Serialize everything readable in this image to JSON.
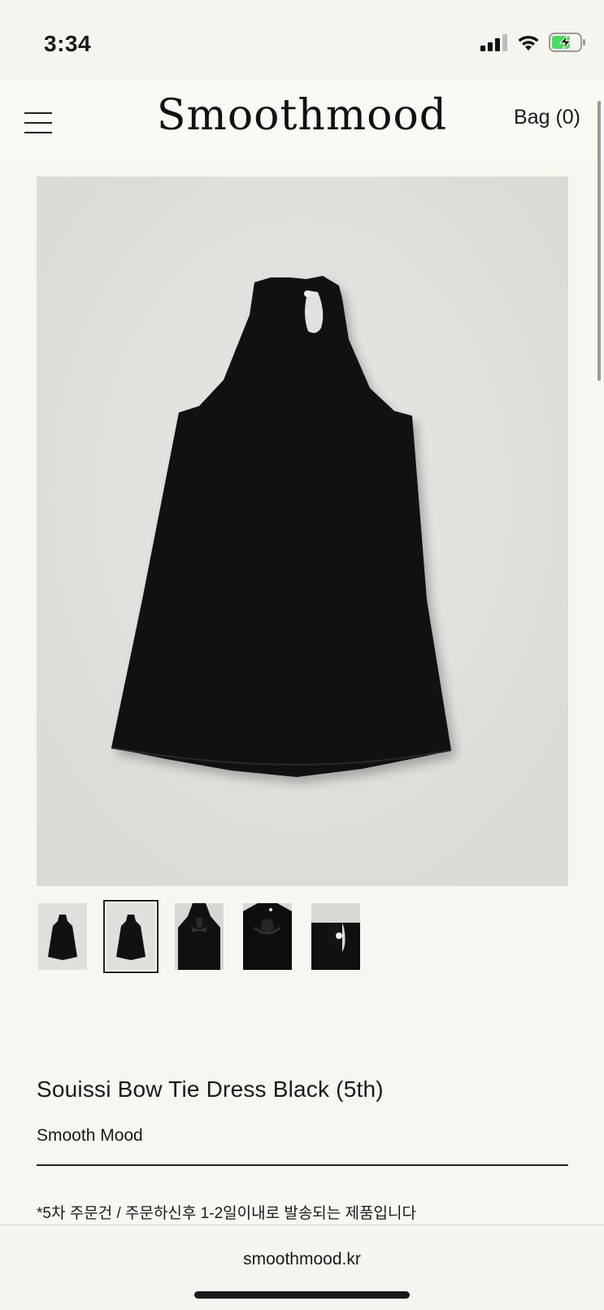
{
  "status_bar": {
    "time": "3:34"
  },
  "header": {
    "brand": "Smoothmood",
    "bag_label": "Bag (0)"
  },
  "product": {
    "title": "Souissi Bow Tie Dress Black (5th)",
    "brand": "Smooth Mood",
    "note": "*5차 주문건 / 주문하신후 1-2일이내로 발송되는 제품입니다"
  },
  "thumbnails": [
    {
      "name": "front-view",
      "selected": false
    },
    {
      "name": "front-view-alt",
      "selected": true
    },
    {
      "name": "back-tie-view",
      "selected": false
    },
    {
      "name": "bow-detail",
      "selected": false
    },
    {
      "name": "button-detail",
      "selected": false
    }
  ],
  "browser": {
    "url": "smoothmood.kr"
  },
  "colors": {
    "background": "#f8f6f0",
    "dress": "#111111",
    "image_bg": "#e3e2de"
  }
}
